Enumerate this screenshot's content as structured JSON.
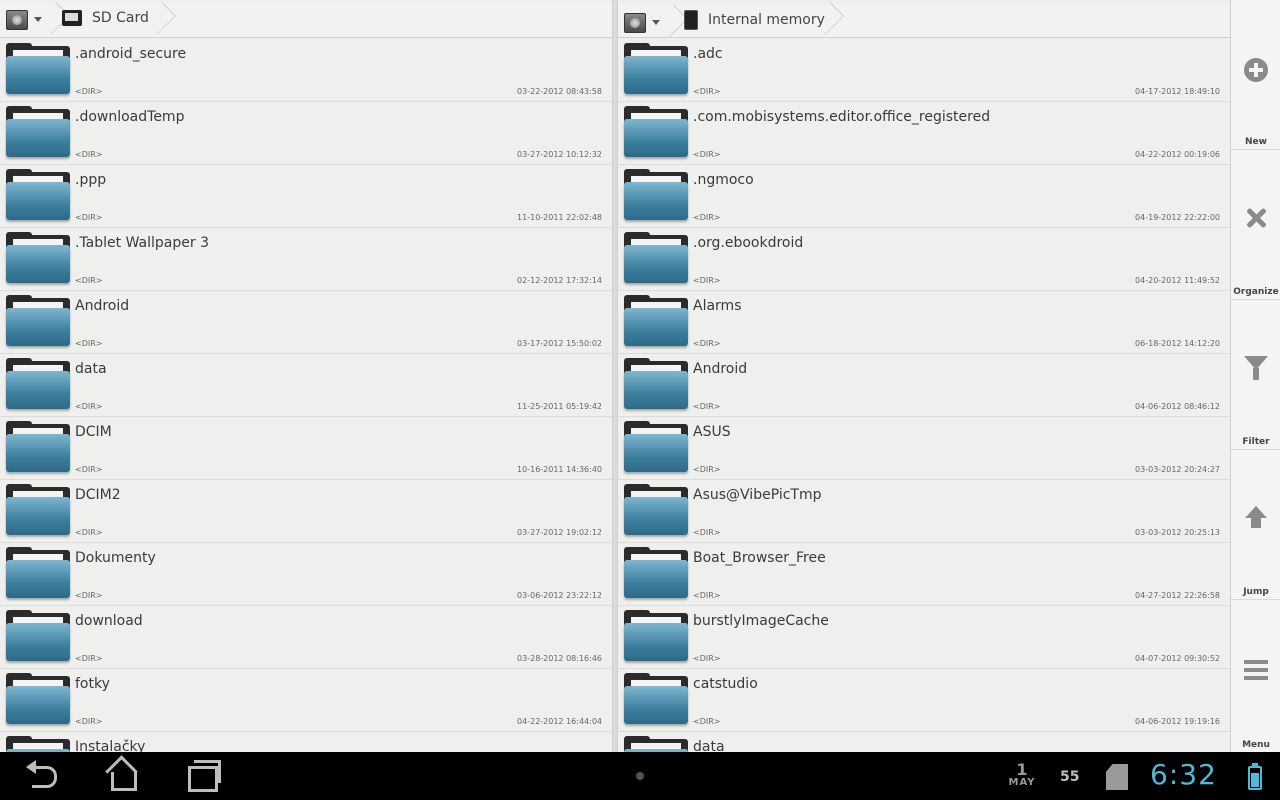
{
  "colors": {
    "active_pane_bar": "#7dd4d8",
    "clock": "#4fb9d6",
    "folder_blue": "#3d7f9f"
  },
  "left_pane": {
    "location": "SD Card",
    "location_icon": "sd-card-icon",
    "items": [
      {
        "name": ".android_secure",
        "type": "<DIR>",
        "date": "03-22-2012 08:43:58"
      },
      {
        "name": ".downloadTemp",
        "type": "<DIR>",
        "date": "03-27-2012 10:12:32"
      },
      {
        "name": ".ppp",
        "type": "<DIR>",
        "date": "11-10-2011 22:02:48"
      },
      {
        "name": ".Tablet Wallpaper 3",
        "type": "<DIR>",
        "date": "02-12-2012 17:32:14"
      },
      {
        "name": "Android",
        "type": "<DIR>",
        "date": "03-17-2012 15:50:02"
      },
      {
        "name": "data",
        "type": "<DIR>",
        "date": "11-25-2011 05:19:42"
      },
      {
        "name": "DCIM",
        "type": "<DIR>",
        "date": "10-16-2011 14:36:40"
      },
      {
        "name": "DCIM2",
        "type": "<DIR>",
        "date": "03-27-2012 19:02:12"
      },
      {
        "name": "Dokumenty",
        "type": "<DIR>",
        "date": "03-06-2012 23:22:12"
      },
      {
        "name": "download",
        "type": "<DIR>",
        "date": "03-28-2012 08:16:46"
      },
      {
        "name": "fotky",
        "type": "<DIR>",
        "date": "04-22-2012 16:44:04"
      },
      {
        "name": "Instalačky",
        "type": "",
        "date": ""
      }
    ]
  },
  "right_pane": {
    "location": "Internal memory",
    "location_icon": "phone-icon",
    "items": [
      {
        "name": ".adc",
        "type": "<DIR>",
        "date": "04-17-2012 18:49:10"
      },
      {
        "name": ".com.mobisystems.editor.office_registered",
        "type": "<DIR>",
        "date": "04-22-2012 00:19:06"
      },
      {
        "name": ".ngmoco",
        "type": "<DIR>",
        "date": "04-19-2012 22:22:00"
      },
      {
        "name": ".org.ebookdroid",
        "type": "<DIR>",
        "date": "04-20-2012 11:49:52"
      },
      {
        "name": "Alarms",
        "type": "<DIR>",
        "date": "06-18-2012 14:12:20"
      },
      {
        "name": "Android",
        "type": "<DIR>",
        "date": "04-06-2012 08:46:12"
      },
      {
        "name": "ASUS",
        "type": "<DIR>",
        "date": "03-03-2012 20:24:27"
      },
      {
        "name": "Asus@VibePicTmp",
        "type": "<DIR>",
        "date": "03-03-2012 20:25:13"
      },
      {
        "name": "Boat_Browser_Free",
        "type": "<DIR>",
        "date": "04-27-2012 22:26:58"
      },
      {
        "name": "burstlyImageCache",
        "type": "<DIR>",
        "date": "04-07-2012 09:30:52"
      },
      {
        "name": "catstudio",
        "type": "<DIR>",
        "date": "04-06-2012 19:19:16"
      },
      {
        "name": "data",
        "type": "",
        "date": ""
      }
    ]
  },
  "sidebar": {
    "new_label": "New",
    "organize_label": "Organize",
    "filter_label": "Filter",
    "jump_label": "Jump",
    "menu_label": "Menu"
  },
  "status_bar": {
    "day": "1",
    "month": "MAY",
    "notification_count": "55",
    "time": "6:32"
  }
}
